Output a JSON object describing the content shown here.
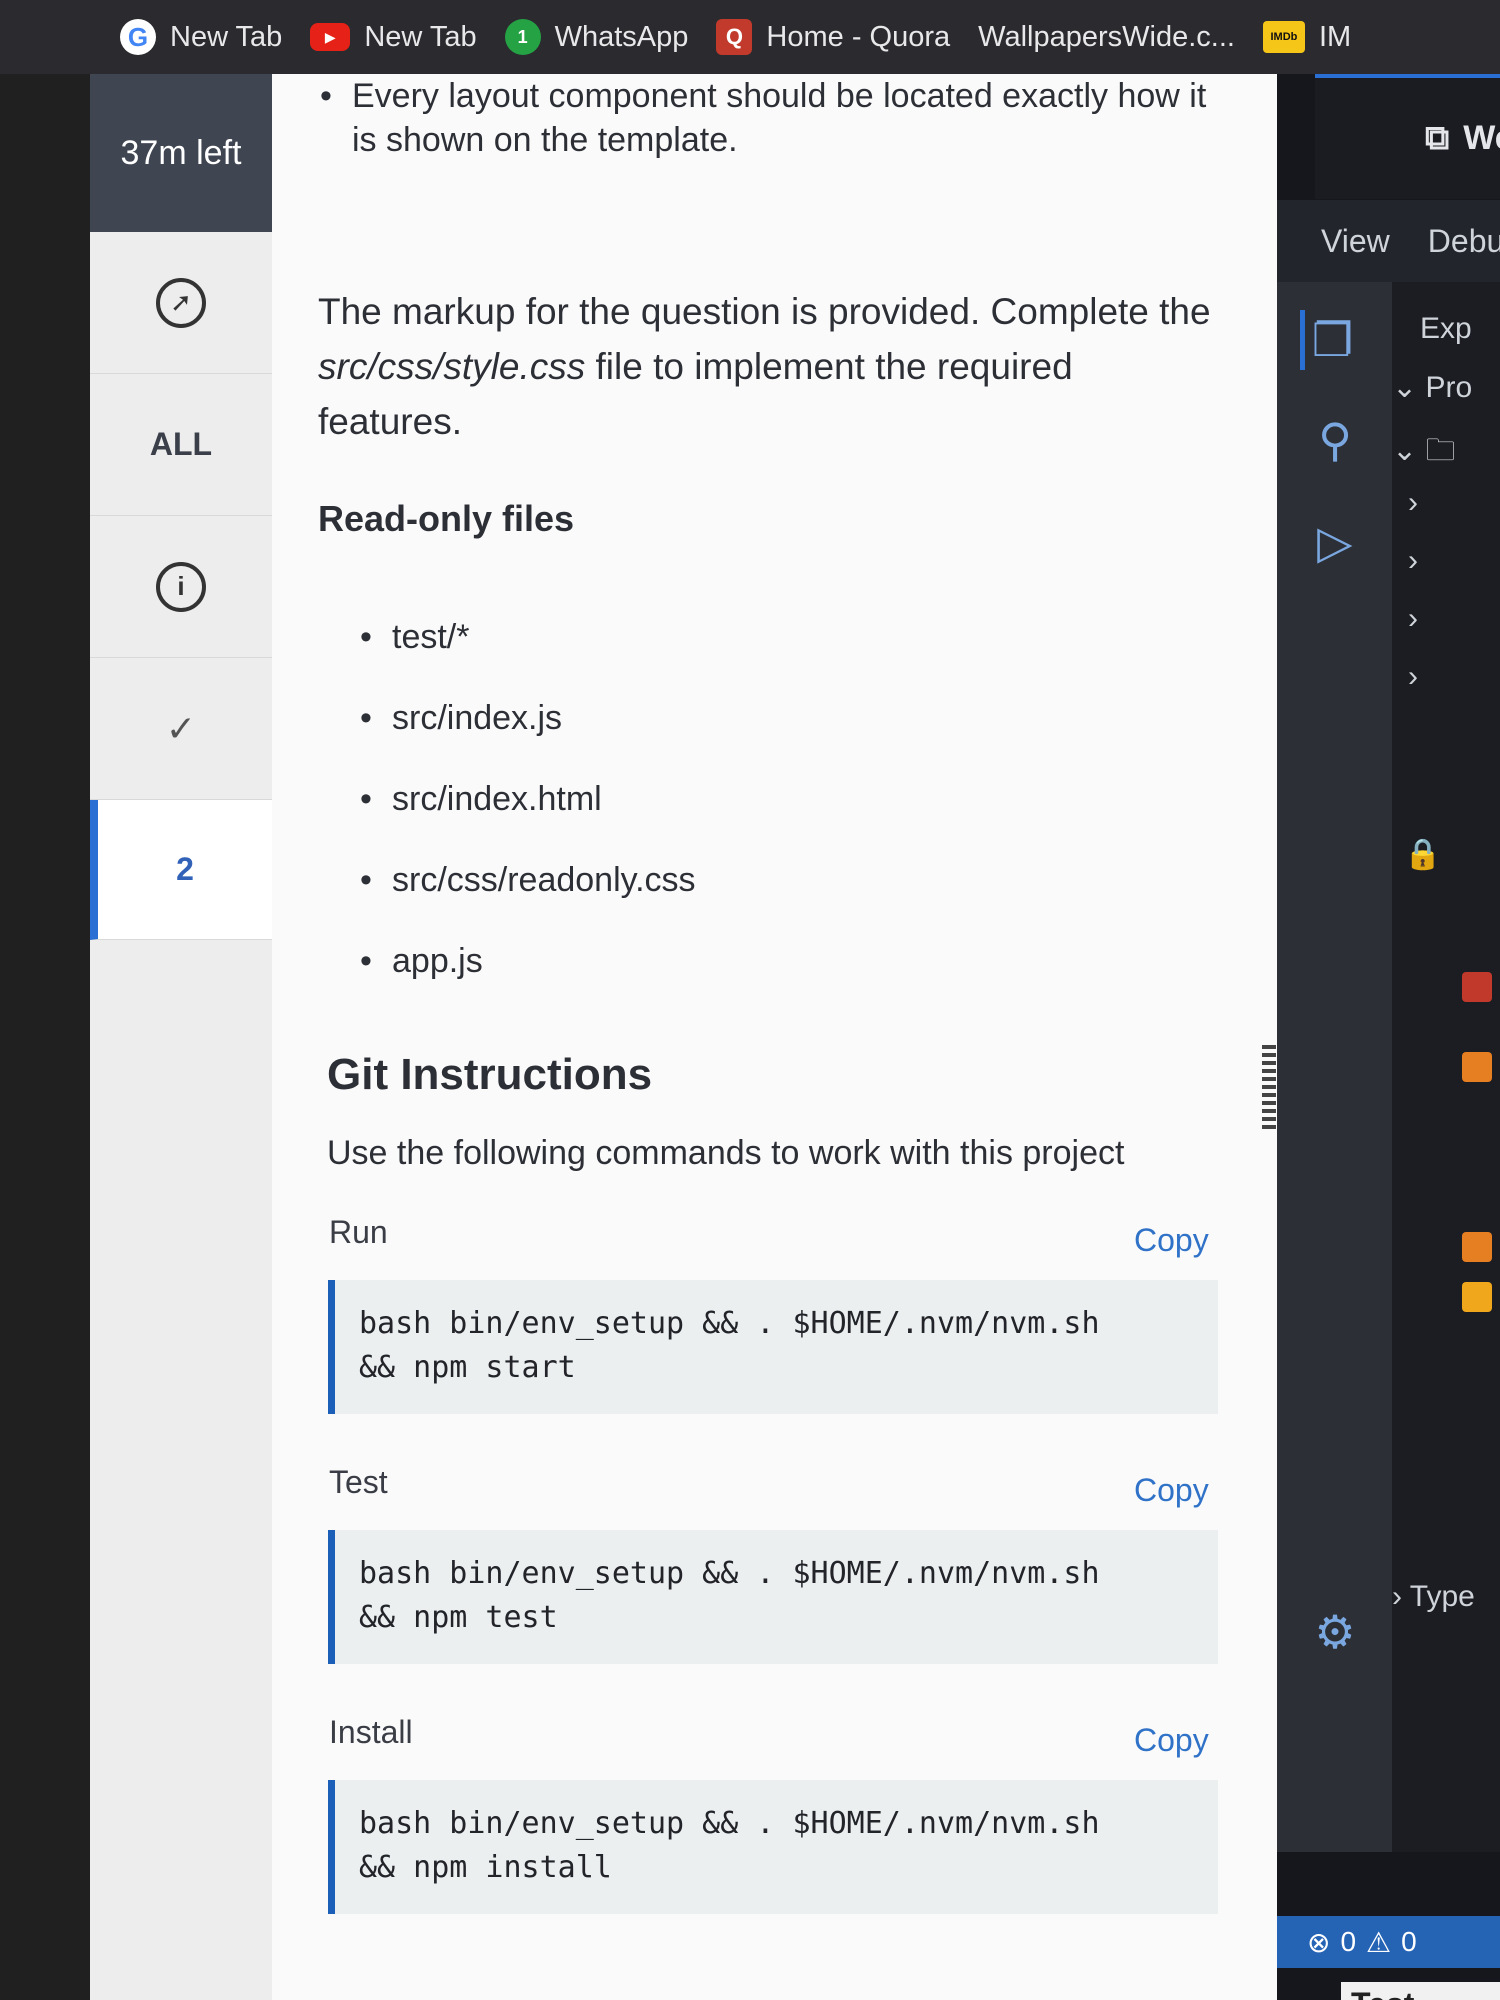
{
  "bookmarks": [
    {
      "label": "New Tab",
      "icon": "google-icon"
    },
    {
      "label": "New Tab",
      "icon": "youtube-icon"
    },
    {
      "label": "WhatsApp",
      "icon": "whatsapp-icon",
      "badge": "1"
    },
    {
      "label": "Home - Quora",
      "icon": "quora-icon"
    },
    {
      "label": "WallpapersWide.c...",
      "icon": "wallpaperswide-icon"
    },
    {
      "label": "IM",
      "icon": "imdb-icon",
      "icon_text": "IMDb"
    }
  ],
  "sidebar": {
    "timer": "37m left",
    "filter_all": "ALL",
    "current_question": "2"
  },
  "instructions": {
    "top_bullet": "Every layout component should be located exactly how it is shown on the template.",
    "intro_pre": "The markup for the question is provided. Complete the ",
    "intro_path": "src/css/style.css",
    "intro_post": " file to implement the required features.",
    "readonly_heading": "Read-only files",
    "readonly_files": [
      "test/*",
      "src/index.js",
      "src/index.html",
      "src/css/readonly.css",
      "app.js"
    ],
    "git_heading": "Git Instructions",
    "git_description": "Use the following commands to work with this project",
    "commands": [
      {
        "label": "Run",
        "copy": "Copy",
        "code": "bash bin/env_setup && . $HOME/.nvm/nvm.sh\n&& npm start"
      },
      {
        "label": "Test",
        "copy": "Copy",
        "code": "bash bin/env_setup && . $HOME/.nvm/nvm.sh\n&& npm test"
      },
      {
        "label": "Install",
        "copy": "Copy",
        "code": "bash bin/env_setup && . $HOME/.nvm/nvm.sh\n&& npm install"
      }
    ]
  },
  "ide": {
    "header_title": "Wel",
    "menu": [
      "View",
      "Debu"
    ],
    "explorer_title": "Exp",
    "project_label": "Pro",
    "type_label": "Type",
    "errors": "0",
    "warnings": "0",
    "test_results": "Test Resu"
  },
  "colors": {
    "accent": "#2a6fd4",
    "link": "#2f72c8",
    "timer_bg": "#3f4551",
    "statusbar": "#2563b5"
  }
}
